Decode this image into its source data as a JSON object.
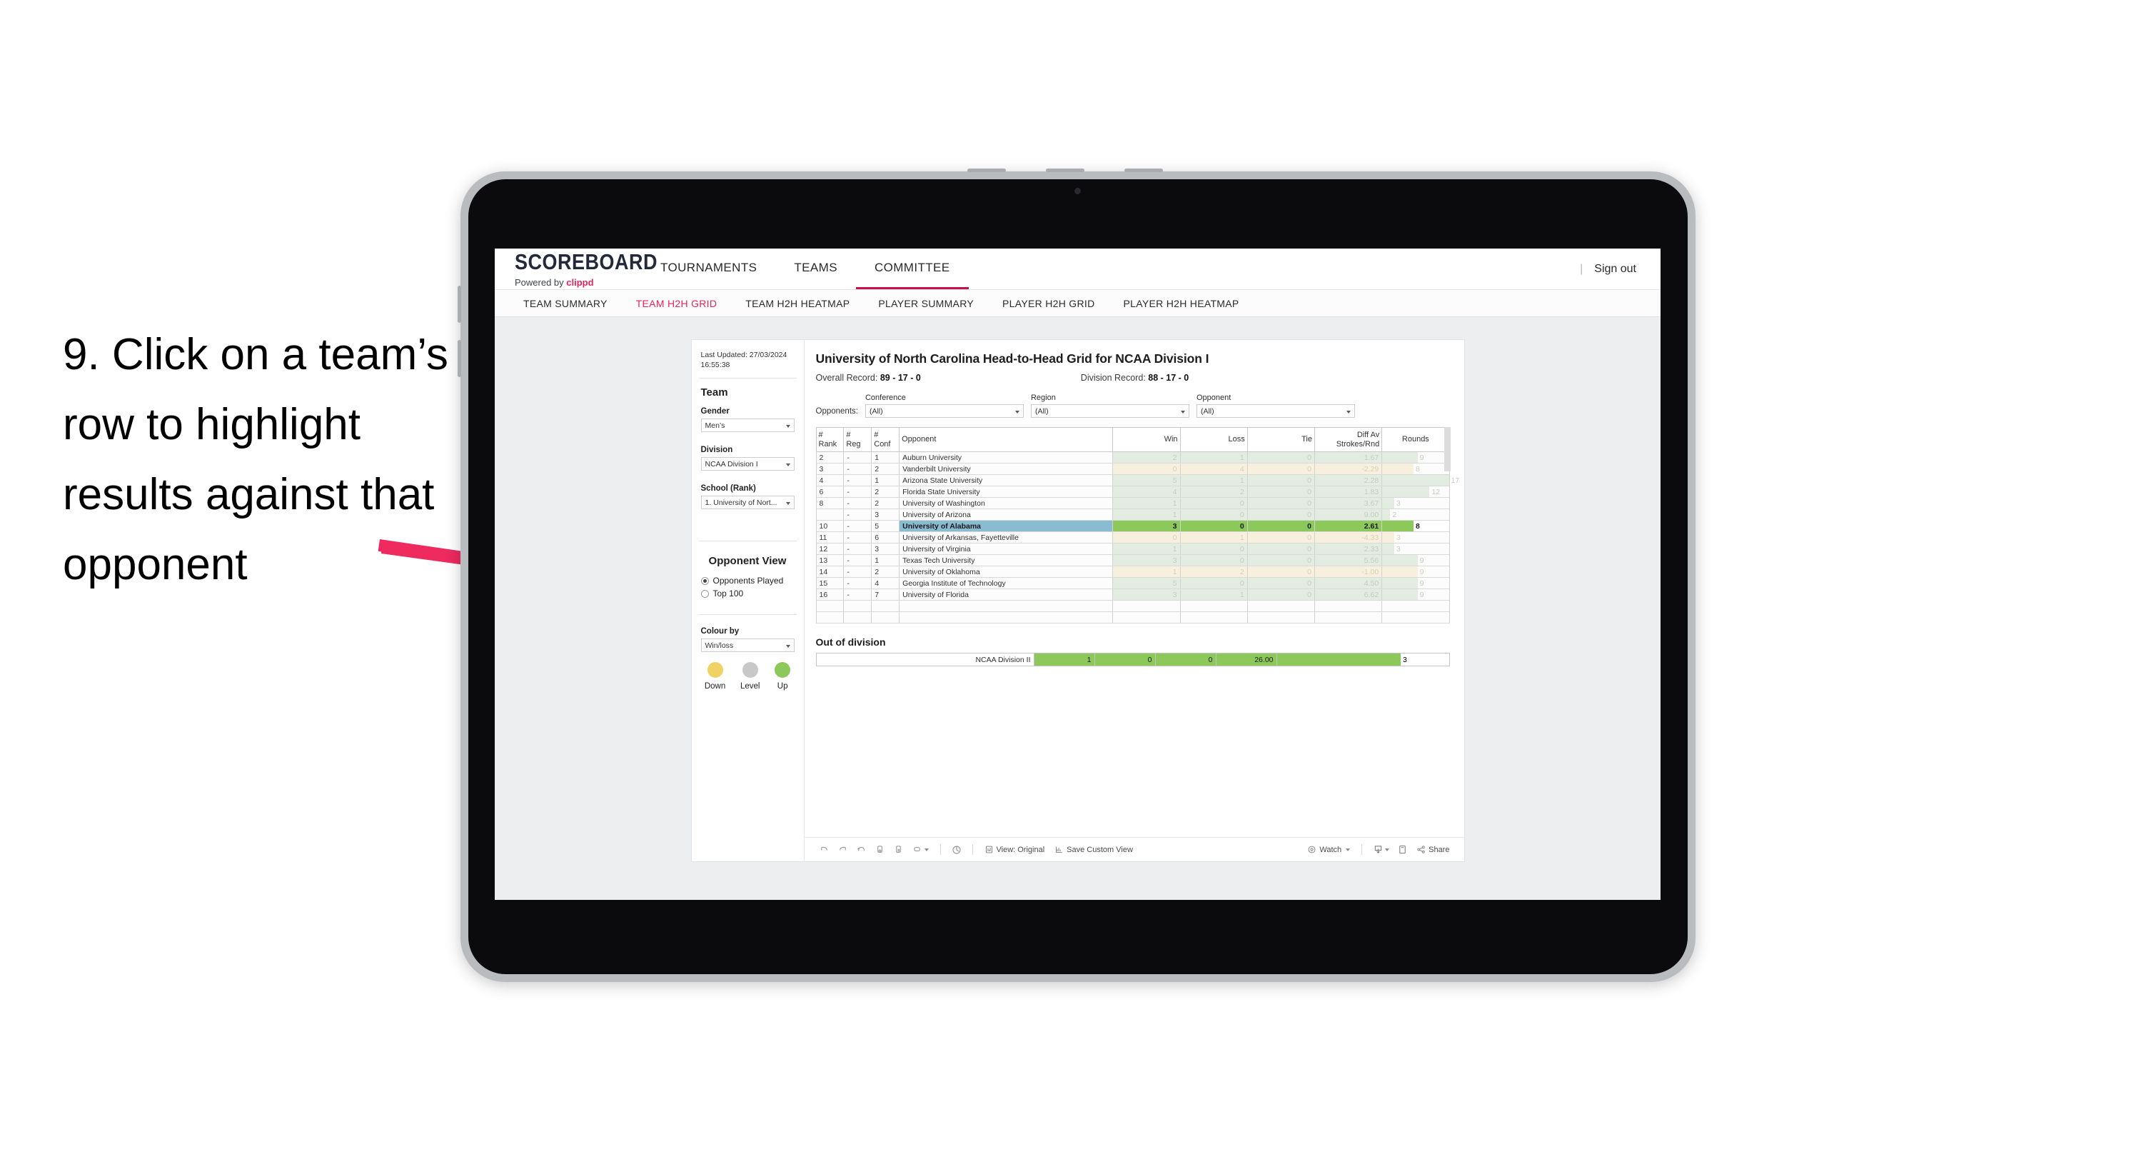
{
  "annotation": {
    "text": "9. Click on a team’s row to highlight results against that opponent",
    "arrow_color": "#ee2a5f"
  },
  "app": {
    "brand_title": "SCOREBOARD",
    "brand_sub_prefix": "Powered by ",
    "brand_sub_name": "clippd",
    "top_nav": [
      {
        "label": "TOURNAMENTS",
        "active": false
      },
      {
        "label": "TEAMS",
        "active": false
      },
      {
        "label": "COMMITTEE",
        "active": true
      }
    ],
    "sign_out": "Sign out",
    "sub_nav": [
      {
        "label": "TEAM SUMMARY",
        "active": false
      },
      {
        "label": "TEAM H2H GRID",
        "active": true
      },
      {
        "label": "TEAM H2H HEATMAP",
        "active": false
      },
      {
        "label": "PLAYER SUMMARY",
        "active": false
      },
      {
        "label": "PLAYER H2H GRID",
        "active": false
      },
      {
        "label": "PLAYER H2H HEATMAP",
        "active": false
      }
    ]
  },
  "sidebar": {
    "last_updated": "Last Updated: 27/03/2024 16:55:38",
    "team_heading": "Team",
    "gender_label": "Gender",
    "gender_value": "Men’s",
    "division_label": "Division",
    "division_value": "NCAA Division I",
    "school_label": "School (Rank)",
    "school_value": "1. University of Nort...",
    "opponent_view_heading": "Opponent View",
    "opponent_view_options": [
      {
        "label": "Opponents Played",
        "selected": true
      },
      {
        "label": "Top 100",
        "selected": false
      }
    ],
    "colour_by_label": "Colour by",
    "colour_by_value": "Win/loss",
    "legend": [
      {
        "label": "Down",
        "color": "#f0d264"
      },
      {
        "label": "Level",
        "color": "#c8c8c8"
      },
      {
        "label": "Up",
        "color": "#8dc85a"
      }
    ]
  },
  "main": {
    "title": "University of North Carolina Head-to-Head Grid for NCAA Division I",
    "overall_record_label": "Overall Record: ",
    "overall_record_value": "89 - 17 - 0",
    "division_record_label": "Division Record: ",
    "division_record_value": "88 - 17 - 0",
    "opponents_label": "Opponents:",
    "filters": [
      {
        "label": "Conference",
        "value": "(All)"
      },
      {
        "label": "Region",
        "value": "(All)"
      },
      {
        "label": "Opponent",
        "value": "(All)"
      }
    ]
  },
  "chart_data": {
    "type": "table",
    "title": "University of North Carolina Head-to-Head Grid for NCAA Division I",
    "columns": [
      "# Rank",
      "# Reg",
      "# Conf",
      "Opponent",
      "Win",
      "Loss",
      "Tie",
      "Diff Av Strokes/Rnd",
      "Rounds"
    ],
    "rows": [
      {
        "rank": "2",
        "reg": "-",
        "conf": "1",
        "opponent": "Auburn University",
        "win": "2",
        "loss": "1",
        "tie": "0",
        "diff": "1.67",
        "rounds": 9,
        "result": "win",
        "selected": false
      },
      {
        "rank": "3",
        "reg": "-",
        "conf": "2",
        "opponent": "Vanderbilt University",
        "win": "0",
        "loss": "4",
        "tie": "0",
        "diff": "-2.29",
        "rounds": 8,
        "result": "loss",
        "selected": false
      },
      {
        "rank": "4",
        "reg": "-",
        "conf": "1",
        "opponent": "Arizona State University",
        "win": "5",
        "loss": "1",
        "tie": "0",
        "diff": "2.28",
        "rounds": 17,
        "result": "win",
        "selected": false
      },
      {
        "rank": "6",
        "reg": "-",
        "conf": "2",
        "opponent": "Florida State University",
        "win": "4",
        "loss": "2",
        "tie": "0",
        "diff": "1.83",
        "rounds": 12,
        "result": "win",
        "selected": false
      },
      {
        "rank": "8",
        "reg": "-",
        "conf": "2",
        "opponent": "University of Washington",
        "win": "1",
        "loss": "0",
        "tie": "0",
        "diff": "3.67",
        "rounds": 3,
        "result": "win",
        "selected": false
      },
      {
        "rank": "",
        "reg": "-",
        "conf": "3",
        "opponent": "University of Arizona",
        "win": "1",
        "loss": "0",
        "tie": "0",
        "diff": "9.00",
        "rounds": 2,
        "result": "win",
        "selected": false
      },
      {
        "rank": "10",
        "reg": "-",
        "conf": "5",
        "opponent": "University of Alabama",
        "win": "3",
        "loss": "0",
        "tie": "0",
        "diff": "2.61",
        "rounds": 8,
        "result": "win",
        "selected": true
      },
      {
        "rank": "11",
        "reg": "-",
        "conf": "6",
        "opponent": "University of Arkansas, Fayetteville",
        "win": "0",
        "loss": "1",
        "tie": "0",
        "diff": "-4.33",
        "rounds": 3,
        "result": "loss",
        "selected": false
      },
      {
        "rank": "12",
        "reg": "-",
        "conf": "3",
        "opponent": "University of Virginia",
        "win": "1",
        "loss": "0",
        "tie": "0",
        "diff": "2.33",
        "rounds": 3,
        "result": "win",
        "selected": false
      },
      {
        "rank": "13",
        "reg": "-",
        "conf": "1",
        "opponent": "Texas Tech University",
        "win": "3",
        "loss": "0",
        "tie": "0",
        "diff": "5.56",
        "rounds": 9,
        "result": "win",
        "selected": false
      },
      {
        "rank": "14",
        "reg": "-",
        "conf": "2",
        "opponent": "University of Oklahoma",
        "win": "1",
        "loss": "2",
        "tie": "0",
        "diff": "-1.00",
        "rounds": 9,
        "result": "loss",
        "selected": false
      },
      {
        "rank": "15",
        "reg": "-",
        "conf": "4",
        "opponent": "Georgia Institute of Technology",
        "win": "5",
        "loss": "0",
        "tie": "0",
        "diff": "4.50",
        "rounds": 9,
        "result": "win",
        "selected": false
      },
      {
        "rank": "16",
        "reg": "-",
        "conf": "7",
        "opponent": "University of Florida",
        "win": "3",
        "loss": "1",
        "tie": "0",
        "diff": "6.62",
        "rounds": 9,
        "result": "win",
        "selected": false
      }
    ],
    "rounds_max": 17,
    "out_of_division": {
      "title": "Out of division",
      "label": "NCAA Division II",
      "win": "1",
      "loss": "0",
      "tie": "0",
      "diff": "26.00",
      "rounds": "3"
    }
  },
  "toolbar": {
    "view_label": "View: Original",
    "save_label": "Save Custom View",
    "watch_label": "Watch",
    "share_label": "Share"
  }
}
